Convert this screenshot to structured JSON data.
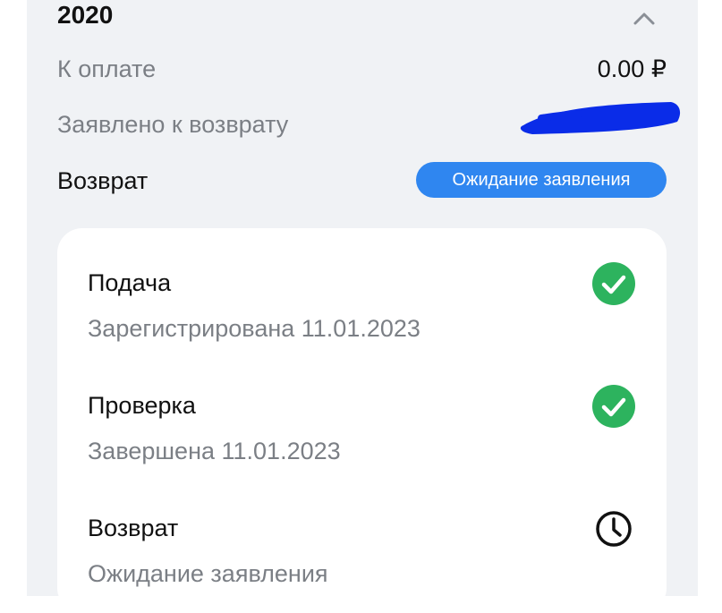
{
  "header": {
    "year": "2020",
    "collapse_icon": "chevron-up-icon"
  },
  "summary": {
    "to_pay_label": "К оплате",
    "to_pay_value": "0.00 ₽",
    "declared_label": "Заявлено к возврату",
    "refund_label": "Возврат",
    "refund_status": "Ожидание заявления",
    "badge_color": "#2f86f0"
  },
  "steps": [
    {
      "title": "Подача",
      "subtitle": "Зарегистрирована 11.01.2023",
      "icon": "check-circle-icon",
      "color": "#2db35e"
    },
    {
      "title": "Проверка",
      "subtitle": "Завершена 11.01.2023",
      "icon": "check-circle-icon",
      "color": "#2db35e"
    },
    {
      "title": "Возврат",
      "subtitle": "Ожидание заявления",
      "icon": "clock-icon",
      "color": "#111111"
    }
  ]
}
